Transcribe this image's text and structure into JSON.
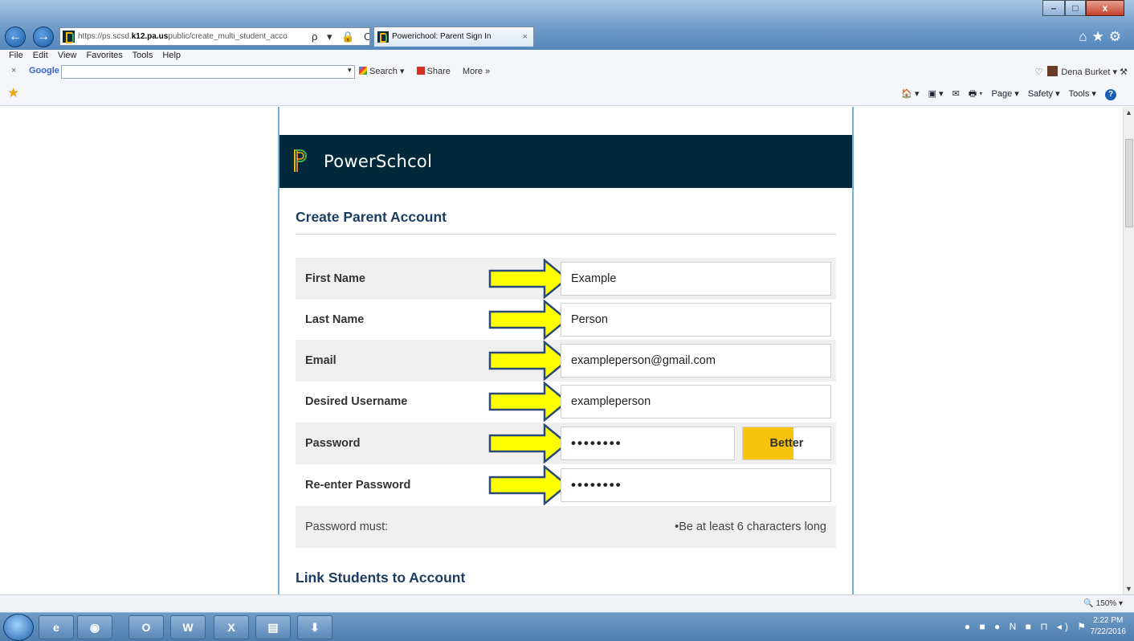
{
  "browser": {
    "url_prefix": "https://ps.scsd.",
    "url_domain": "k12.pa.us",
    "url_path": "public/create_multi_student_acco",
    "address_tools": "ρ ▾ 🔒 C",
    "tab_title": "Powerichool: Parent Sign In",
    "tab_close": "×",
    "window_controls": {
      "minimize": "–",
      "maximize": "□",
      "close": "x"
    },
    "right_icons": "⌂★⚙"
  },
  "menu": {
    "items": [
      "File",
      "Edit",
      "View",
      "Favorites",
      "Tools",
      "Help"
    ]
  },
  "google_toolbar": {
    "close": "×",
    "label": "Google",
    "dropdown": "▾",
    "search_label": "Search ▾",
    "share_label": "Share",
    "more_label": "More »",
    "user_name": "Dena Burket ▾"
  },
  "command_bar": {
    "home": "🏠 ▾",
    "feeds": "▣ ▾",
    "mail": "✉",
    "print": "🖶 ▾",
    "page": "Page ▾",
    "safety": "Safety ▾",
    "tools": "Tools ▾",
    "help": "?"
  },
  "page": {
    "brand": "PowerSchcol",
    "heading": "Create Parent Account",
    "fields": [
      {
        "label": "First Name",
        "value": "Example"
      },
      {
        "label": "Last Name",
        "value": "Person"
      },
      {
        "label": "Email",
        "value": "exampleperson@gmail.com"
      },
      {
        "label": "Desired Username",
        "value": "exampleperson"
      },
      {
        "label": "Password",
        "value": "••••••••"
      },
      {
        "label": "Re-enter Password",
        "value": "••••••••"
      }
    ],
    "password_strength": {
      "label": "Better",
      "fill_fraction": 0.58,
      "color": "#f7c30d"
    },
    "password_rules_label": "Password must:",
    "password_rules": [
      "•Be at least 6 characters long"
    ],
    "link_heading": "Link Students to Account"
  },
  "annotation": {
    "arrow_color": "#ffff00",
    "arrow_outline": "#2a4a7a"
  },
  "status": {
    "zoom": "🔍 150%  ▾"
  },
  "taskbar": {
    "apps": [
      "e",
      "◉",
      "O",
      "W",
      "X",
      "▤",
      "⬇"
    ],
    "tray": "● ■ ● N ■ ⊓ ◂) ⚑",
    "time": "2:22 PM",
    "date": "7/22/2016"
  },
  "colors": {
    "header_bg": "#02293b",
    "heading": "#1c3d62",
    "frame_border": "#6fb1de"
  }
}
